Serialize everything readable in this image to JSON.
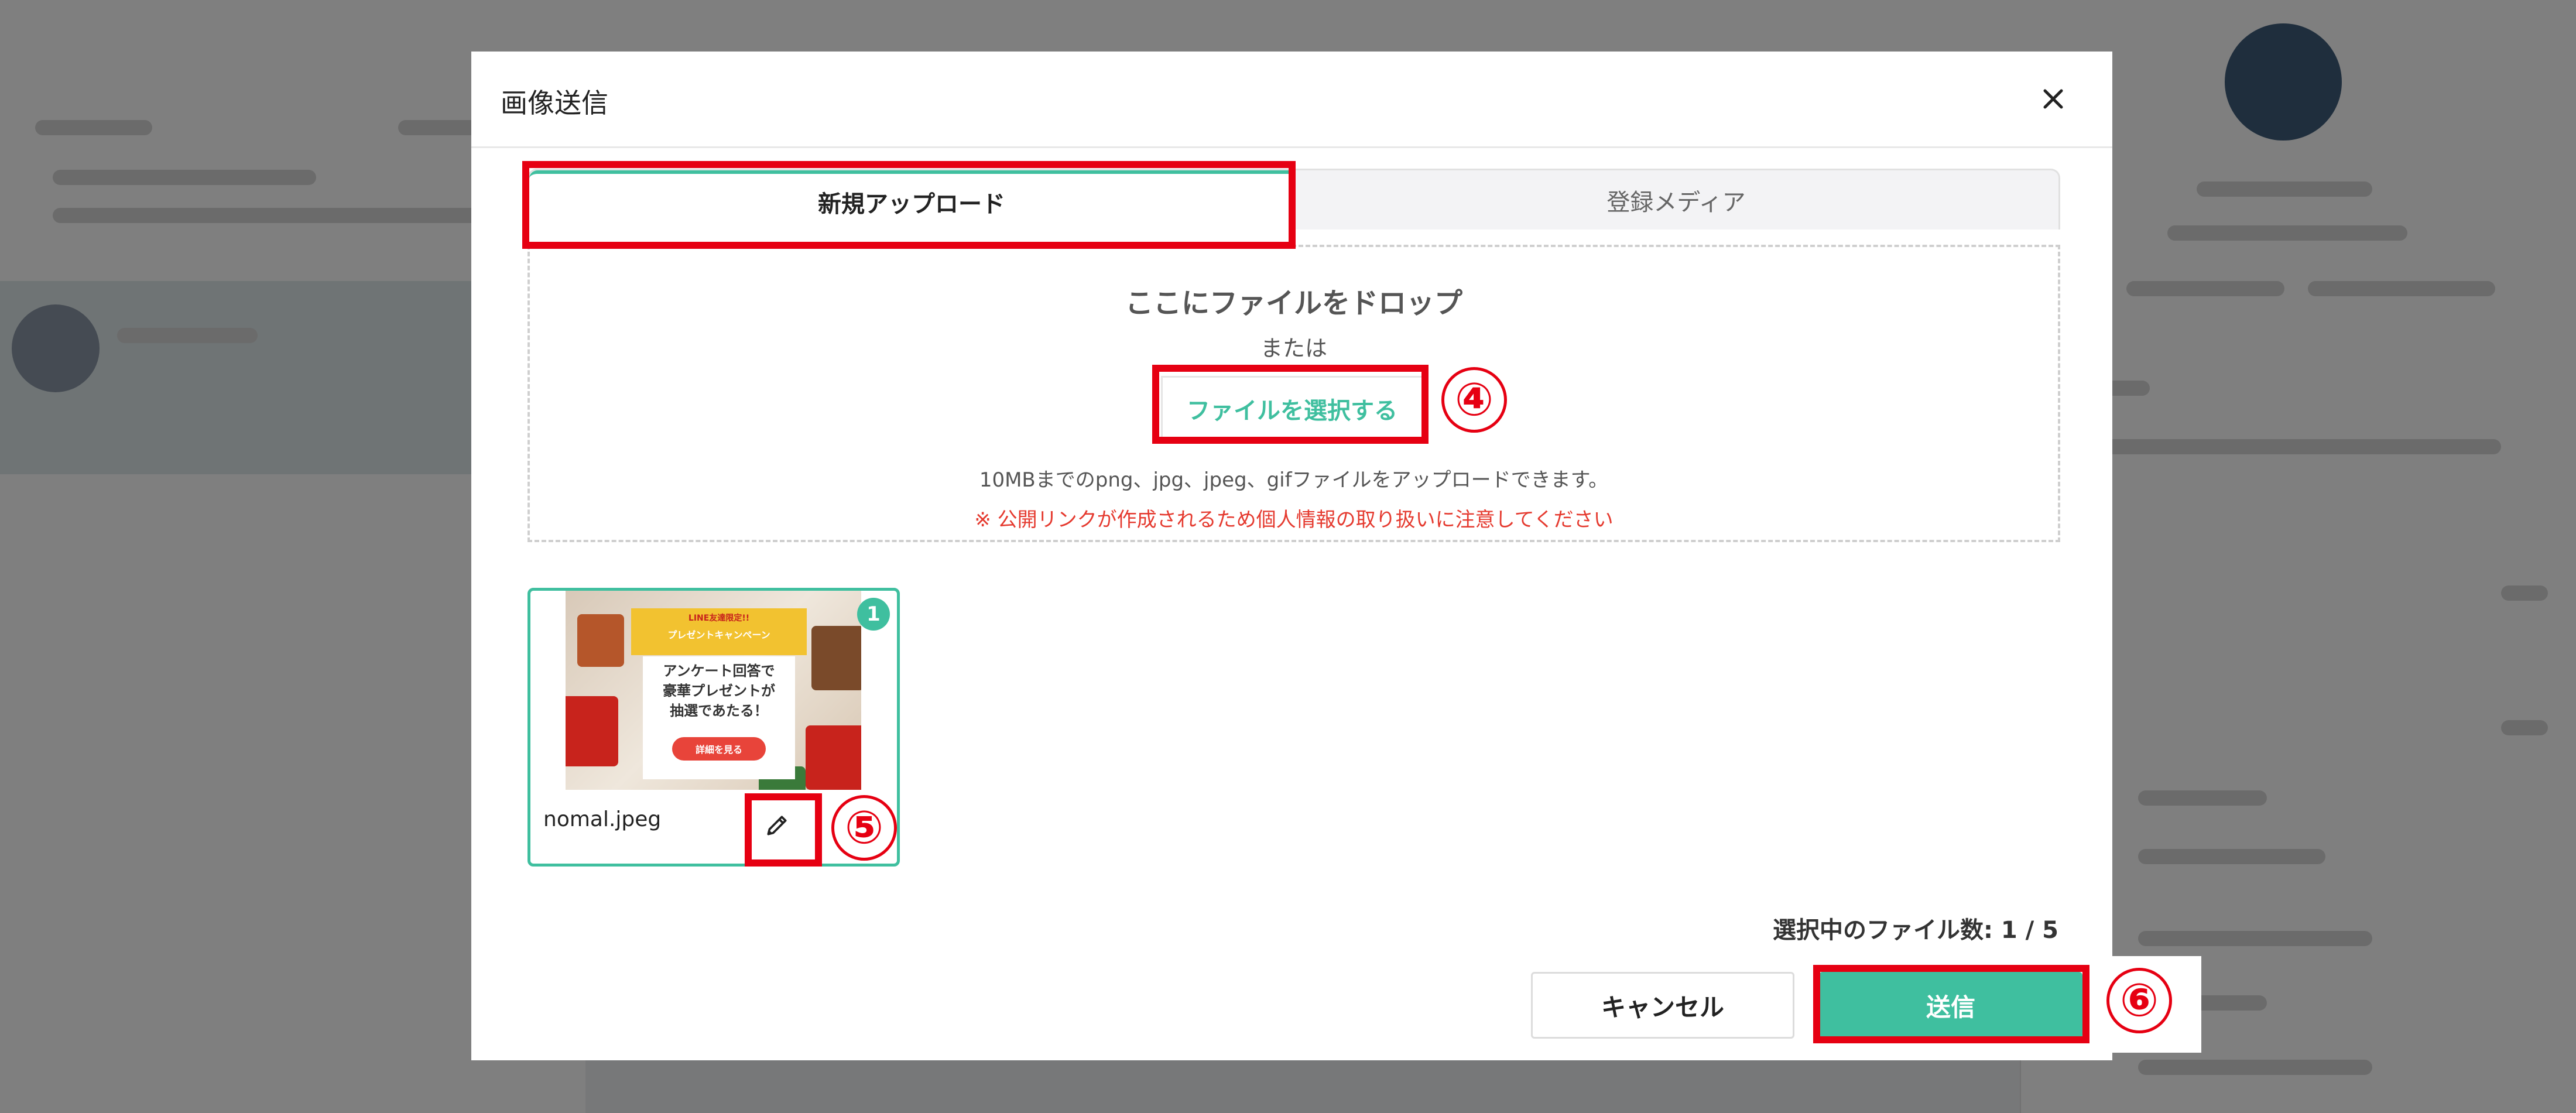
{
  "modal": {
    "title": "画像送信",
    "tabs": [
      {
        "label": "新規アップロード",
        "active": true
      },
      {
        "label": "登録メディア",
        "active": false
      }
    ],
    "dropzone": {
      "title": "ここにファイルをドロップ",
      "or": "または",
      "select_button": "ファイルを選択する",
      "info": "10MBまでのpng、jpg、jpeg、gifファイルをアップロードできます。",
      "warning": "※ 公開リンクが作成されるため個人情報の取り扱いに注意してください"
    },
    "file": {
      "name": "nomal.jpeg",
      "badge": "1",
      "thumbnail": {
        "banner_line1": "LINE友達限定!!",
        "banner_line2": "プレゼントキャンペーン",
        "main_text": "アンケート回答で\n豪華プレゼントが\n抽選であたる！",
        "button": "詳細を見る"
      }
    },
    "selected_count": "選択中のファイル数: 1 / 5",
    "cancel_button": "キャンセル",
    "send_button": "送信"
  },
  "annotations": [
    "④",
    "⑤",
    "⑥"
  ],
  "colors": {
    "accent": "#3fbf9f",
    "warning": "#e53a2f",
    "annotation": "#e60012"
  },
  "icons": {
    "close": "close-icon",
    "edit": "pencil-icon"
  }
}
